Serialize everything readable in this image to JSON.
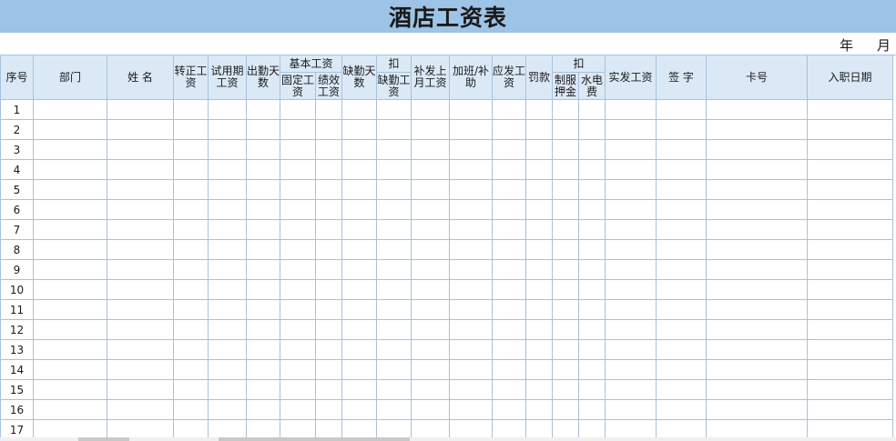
{
  "title": "酒店工资表",
  "year_label": "年",
  "month_label": "月",
  "headers": {
    "seq": "序号",
    "dept": "部门",
    "name": "姓 名",
    "regular_wage": "转正工资",
    "probation_wage": "试用期工资",
    "attendance_days": "出勤天数",
    "basic_wage": "基本工资",
    "fixed_wage": "固定工资",
    "performance_wage": "绩效工资",
    "absence_days": "缺勤天数",
    "deduct_1": "扣",
    "absence_wage": "缺勤工资",
    "back_pay": "补发上月工资",
    "overtime": "加班/补助",
    "gross_pay": "应发工资",
    "fine": "罚款",
    "deduct_2": "扣",
    "uniform_deposit": "制服押金",
    "utilities": "水电费",
    "net_pay": "实发工资",
    "signature": "签 字",
    "card_no": "卡号",
    "hire_date": "入职日期"
  },
  "rows": [
    "1",
    "2",
    "3",
    "4",
    "5",
    "6",
    "7",
    "8",
    "9",
    "10",
    "11",
    "12",
    "13",
    "14",
    "15",
    "16",
    "17"
  ]
}
